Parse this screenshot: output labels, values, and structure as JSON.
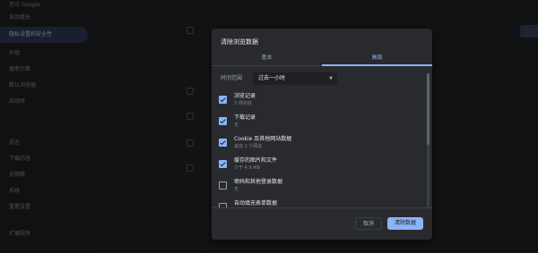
{
  "sidebar": {
    "items": [
      {
        "label": "您与 Google"
      },
      {
        "label": "自动填充"
      },
      {
        "label": "隐私设置和安全性"
      },
      {
        "label": "外观"
      },
      {
        "label": "搜索引擎"
      },
      {
        "label": "默认浏览器"
      },
      {
        "label": "启动时"
      },
      {
        "label": "语言"
      },
      {
        "label": "下载内容"
      },
      {
        "label": "无障碍"
      },
      {
        "label": "系统"
      },
      {
        "label": "重置设置"
      },
      {
        "label": "扩展程序"
      }
    ]
  },
  "dialog": {
    "title": "清除浏览数据",
    "tabs": {
      "basic": "基本",
      "advanced": "高级"
    },
    "time_range": {
      "label": "时间范围",
      "value": "过去一小时"
    },
    "items": [
      {
        "title": "浏览记录",
        "subtitle": "3 项内容",
        "checked": true
      },
      {
        "title": "下载记录",
        "subtitle": "无",
        "checked": true
      },
      {
        "title": "Cookie 及其他网站数据",
        "subtitle": "来自 2 个网站",
        "checked": true
      },
      {
        "title": "缓存的图片和文件",
        "subtitle": "少于 4.9 MB",
        "checked": true
      },
      {
        "title": "密码和其他登录数据",
        "subtitle": "无",
        "checked": false
      },
      {
        "title": "自动填充表单数据",
        "subtitle": "",
        "checked": false
      }
    ],
    "cancel_label": "取消",
    "clear_label": "清除数据"
  },
  "colors": {
    "accent": "#8ab4f8",
    "dialog_bg": "#292a2d",
    "page_bg": "#202124"
  }
}
